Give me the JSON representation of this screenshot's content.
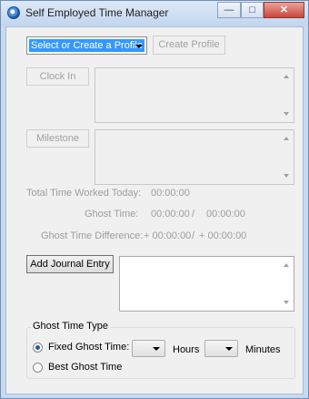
{
  "window": {
    "title": "Self Employed Time Manager",
    "minimize_glyph": "—",
    "maximize_glyph": "□",
    "close_glyph": "✕"
  },
  "profile": {
    "selected": "Select or Create a Profile",
    "create_label": "Create Profile"
  },
  "clock_in_label": "Clock In",
  "milestone_label": "Milestone",
  "stats": {
    "total_time_label": "Total Time Worked Today:",
    "total_time_value": "00:00:00",
    "ghost_time_label": "Ghost Time:",
    "ghost_time_value": "00:00:00",
    "ghost_time_separator": "/",
    "ghost_time_value2": "00:00:00",
    "ghost_diff_label": "Ghost Time Difference:",
    "ghost_diff_value": "+ 00:00:00",
    "ghost_diff_separator": "/",
    "ghost_diff_value2": "+ 00:00:00"
  },
  "journal": {
    "add_label": "Add Journal Entry"
  },
  "ghost_type": {
    "title": "Ghost Time Type",
    "fixed_label": "Fixed Ghost Time:",
    "fixed_checked": true,
    "hours_label": "Hours",
    "minutes_label": "Minutes",
    "best_label": "Best Ghost Time",
    "best_checked": false
  }
}
